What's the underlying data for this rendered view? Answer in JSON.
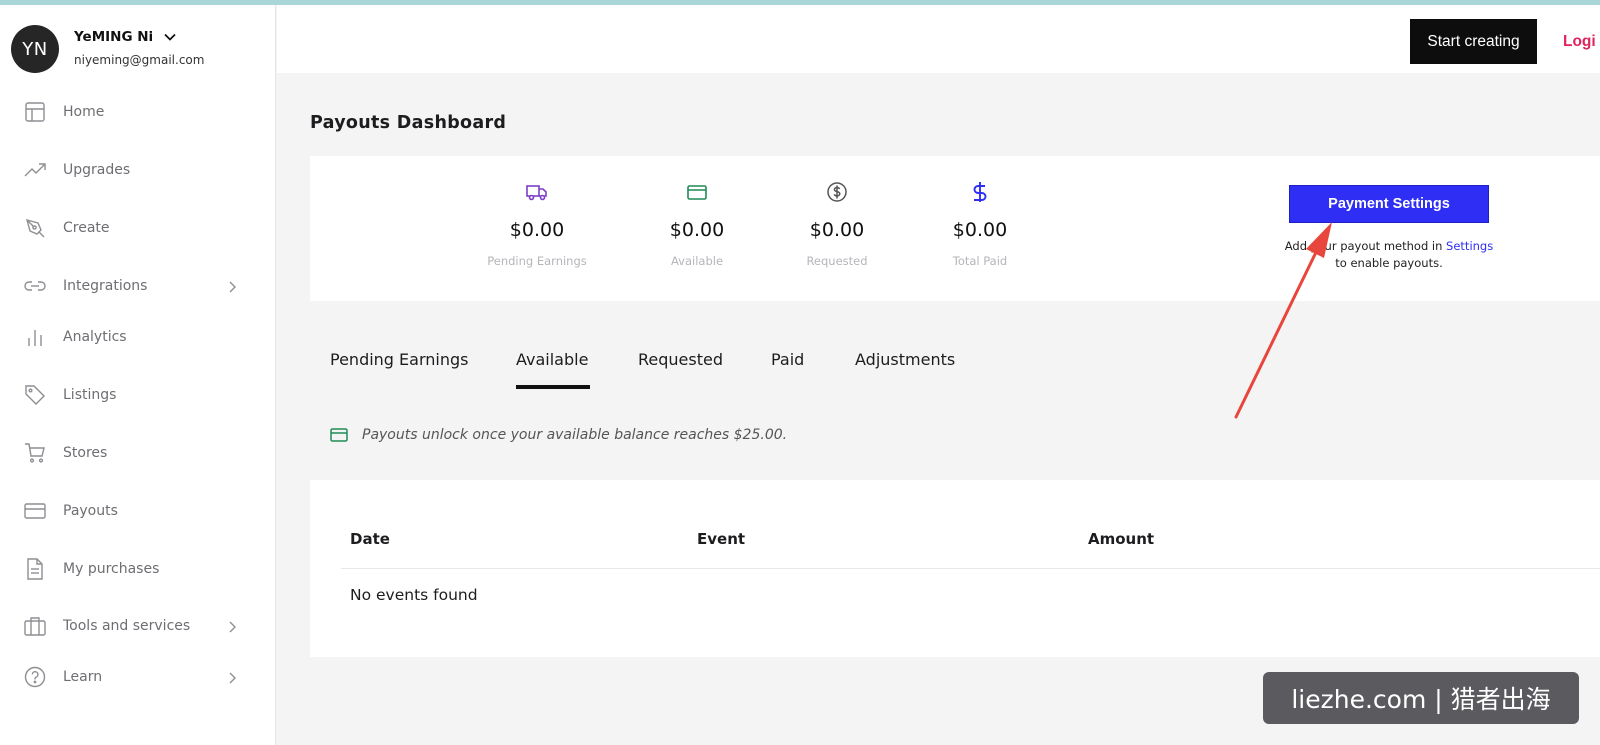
{
  "profile": {
    "initials": "YN",
    "name": "YeMING Ni",
    "email": "niyeming@gmail.com"
  },
  "sidebar": {
    "items": [
      {
        "label": "Home",
        "icon": "layout-icon",
        "has_chevron": false
      },
      {
        "label": "Upgrades",
        "icon": "trending-up-icon",
        "has_chevron": false
      },
      {
        "label": "Create",
        "icon": "pen-tool-icon",
        "has_chevron": false
      },
      {
        "label": "Integrations",
        "icon": "link-icon",
        "has_chevron": true
      },
      {
        "label": "Analytics",
        "icon": "bar-chart-icon",
        "has_chevron": false
      },
      {
        "label": "Listings",
        "icon": "tag-icon",
        "has_chevron": false
      },
      {
        "label": "Stores",
        "icon": "shopping-cart-icon",
        "has_chevron": false
      },
      {
        "label": "Payouts",
        "icon": "credit-card-icon",
        "has_chevron": false
      },
      {
        "label": "My purchases",
        "icon": "file-text-icon",
        "has_chevron": false
      },
      {
        "label": "Tools and services",
        "icon": "briefcase-icon",
        "has_chevron": true
      },
      {
        "label": "Learn",
        "icon": "help-circle-icon",
        "has_chevron": true
      }
    ]
  },
  "header": {
    "start_label": "Start creating",
    "login_label": "Logi"
  },
  "page": {
    "title": "Payouts Dashboard"
  },
  "stats": [
    {
      "value": "$0.00",
      "label": "Pending Earnings",
      "icon": "truck-icon",
      "color": "#7b3fc8"
    },
    {
      "value": "$0.00",
      "label": "Available",
      "icon": "credit-card-icon",
      "color": "#1f8a55"
    },
    {
      "value": "$0.00",
      "label": "Requested",
      "icon": "dollar-circle-icon",
      "color": "#555555"
    },
    {
      "value": "$0.00",
      "label": "Total Paid",
      "icon": "dollar-sign-icon",
      "color": "#2e2ef5"
    }
  ],
  "payment": {
    "button_label": "Payment Settings",
    "note_start": "Add your payout method in ",
    "note_link": "Settings",
    "note_end": " to enable payouts."
  },
  "tabs": [
    {
      "label": "Pending Earnings"
    },
    {
      "label": "Available",
      "active": true
    },
    {
      "label": "Requested"
    },
    {
      "label": "Paid"
    },
    {
      "label": "Adjustments"
    }
  ],
  "notice": {
    "text": "Payouts unlock once your available balance reaches $25.00."
  },
  "table": {
    "headers": [
      "Date",
      "Event",
      "Amount"
    ],
    "empty_text": "No events found"
  },
  "watermark": {
    "text": "liezhe.com | 猎者出海"
  },
  "colors": {
    "accent": "#2e2ef5",
    "login": "#e0245e",
    "annotation": "#e8453c"
  }
}
